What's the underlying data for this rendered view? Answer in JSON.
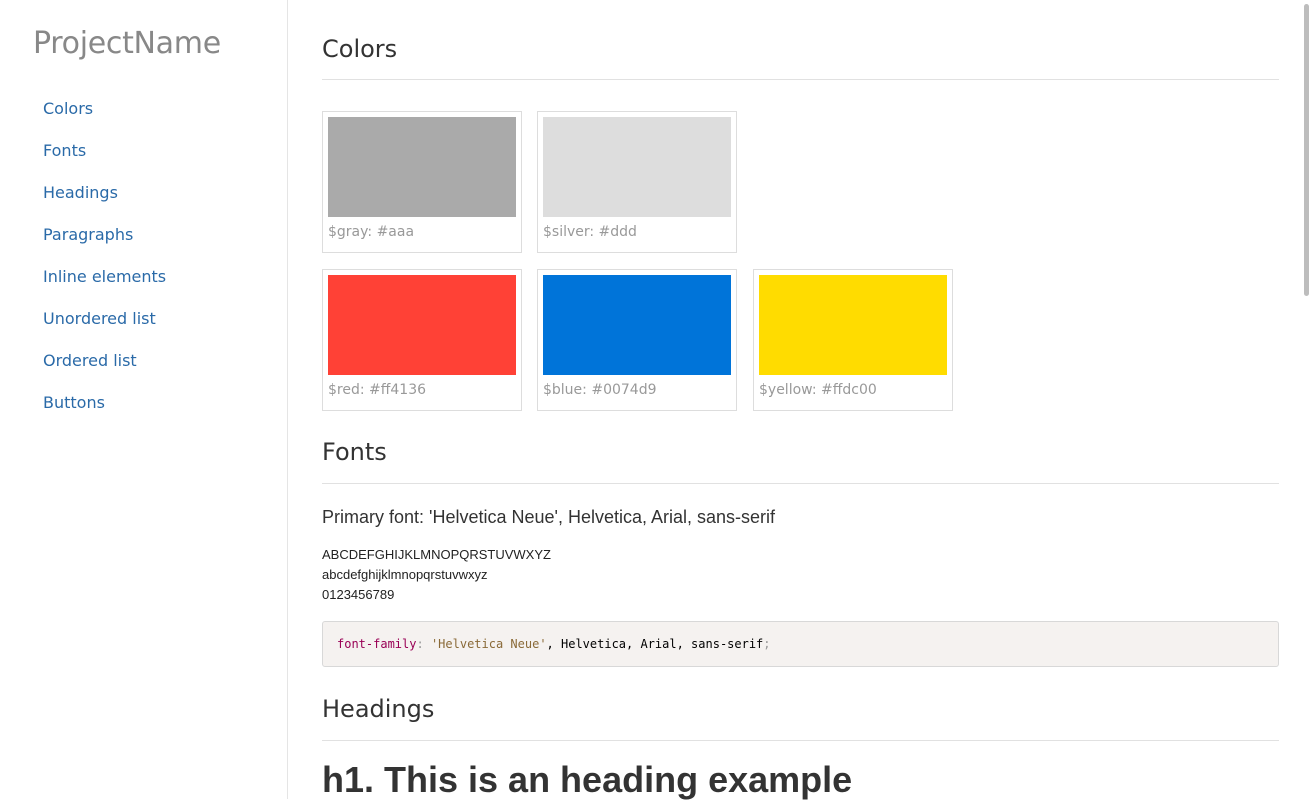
{
  "brand": "ProjectName",
  "nav": [
    "Colors",
    "Fonts",
    "Headings",
    "Paragraphs",
    "Inline elements",
    "Unordered list",
    "Ordered list",
    "Buttons"
  ],
  "sections": {
    "colors": {
      "title": "Colors",
      "swatches": [
        {
          "label": "$gray: #aaa",
          "color": "#aaaaaa"
        },
        {
          "label": "$silver: #ddd",
          "color": "#dddddd"
        },
        {
          "label": "$red: #ff4136",
          "color": "#ff4136"
        },
        {
          "label": "$blue: #0074d9",
          "color": "#0074d9"
        },
        {
          "label": "$yellow: #ffdc00",
          "color": "#ffdc00"
        }
      ]
    },
    "fonts": {
      "title": "Fonts",
      "primary": "Primary font: 'Helvetica Neue', Helvetica, Arial, sans-serif",
      "upper": "ABCDEFGHIJKLMNOPQRSTUVWXYZ",
      "lower": "abcdefghijklmnopqrstuvwxyz",
      "digits": "0123456789",
      "code": {
        "property": "font-family",
        "colon": ":",
        "string": "'Helvetica Neue'",
        "rest": ", Helvetica, Arial, sans-serif",
        "semicolon": ";"
      }
    },
    "headings": {
      "title": "Headings",
      "h1": "h1. This is an heading example"
    }
  }
}
